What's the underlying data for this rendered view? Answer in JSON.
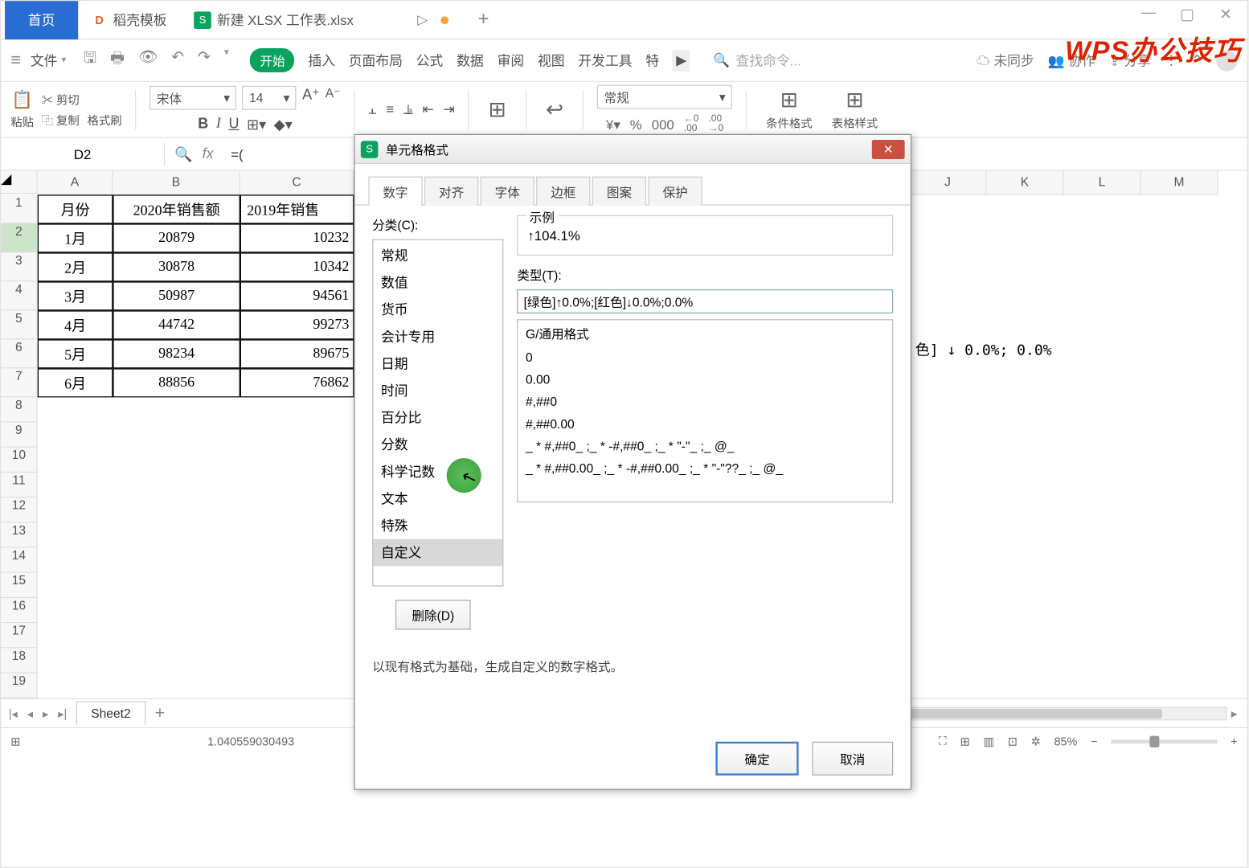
{
  "watermark": "WPS办公技巧",
  "win": {
    "min": "—",
    "max": "▢",
    "close": "✕"
  },
  "tabs": {
    "home": "首页",
    "docker": "稻壳模板",
    "file": "新建 XLSX 工作表.xlsx",
    "add": "+"
  },
  "toolbar1": {
    "file": "文件",
    "ribbon": [
      "开始",
      "插入",
      "页面布局",
      "公式",
      "数据",
      "审阅",
      "视图",
      "开发工具",
      "特"
    ],
    "search_ph": "查找命令...",
    "sync": "未同步",
    "collab": "协作",
    "share": "分享"
  },
  "toolbar2": {
    "paste": "粘贴",
    "cut": "剪切",
    "copy": "复制",
    "fmt": "格式刷",
    "font": "宋体",
    "size": "14",
    "pct": "%",
    "thou": "000",
    "inc": "←0\n.00",
    "dec": ".00\n→0",
    "style": "常规",
    "cond": "条件格式",
    "tblstyle": "表格样式"
  },
  "fbar": {
    "name": "D2",
    "formula": "=("
  },
  "headers": {
    "cols": [
      "A",
      "B",
      "C",
      "J",
      "K",
      "L",
      "M"
    ],
    "row1": [
      "月份",
      "2020年销售额",
      "2019年销售"
    ],
    "data": [
      [
        "1月",
        "20879",
        "10232"
      ],
      [
        "2月",
        "30878",
        "10342"
      ],
      [
        "3月",
        "50987",
        "94561"
      ],
      [
        "4月",
        "44742",
        "99273"
      ],
      [
        "5月",
        "98234",
        "89675"
      ],
      [
        "6月",
        "88856",
        "76862"
      ]
    ]
  },
  "float_text": "色] ↓ 0.0%; 0.0%",
  "sheets": {
    "active": "Sheet2"
  },
  "status": {
    "val": "1.040559030493",
    "zoom": "85%"
  },
  "dialog": {
    "title": "单元格格式",
    "tabs": [
      "数字",
      "对齐",
      "字体",
      "边框",
      "图案",
      "保护"
    ],
    "cat_label": "分类(C):",
    "categories": [
      "常规",
      "数值",
      "货币",
      "会计专用",
      "日期",
      "时间",
      "百分比",
      "分数",
      "科学记数",
      "文本",
      "特殊",
      "自定义"
    ],
    "sample_label": "示例",
    "sample": "↑104.1%",
    "type_label": "类型(T):",
    "type_value": "[绿色]↑0.0%;[红色]↓0.0%;0.0%",
    "type_list": [
      "G/通用格式",
      "0",
      "0.00",
      "#,##0",
      "#,##0.00",
      "_ * #,##0_ ;_ * -#,##0_ ;_ * \"-\"_ ;_ @_",
      "_ * #,##0.00_ ;_ * -#,##0.00_ ;_ * \"-\"??_ ;_ @_"
    ],
    "delete": "删除(D)",
    "desc": "以现有格式为基础，生成自定义的数字格式。",
    "ok": "确定",
    "cancel": "取消"
  }
}
